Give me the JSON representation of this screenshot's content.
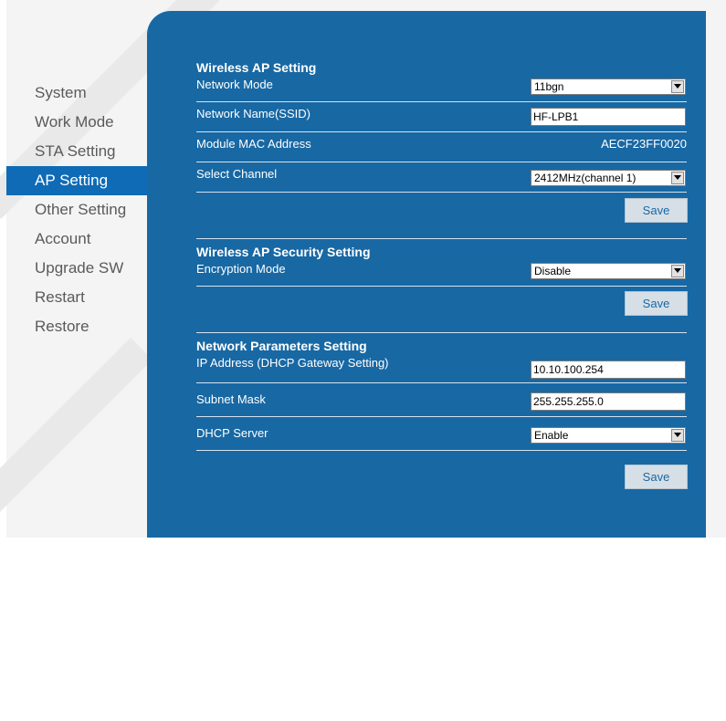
{
  "sidebar": {
    "items": [
      {
        "label": "System"
      },
      {
        "label": "Work Mode"
      },
      {
        "label": "STA Setting"
      },
      {
        "label": "AP Setting",
        "active": true
      },
      {
        "label": "Other Setting"
      },
      {
        "label": "Account"
      },
      {
        "label": "Upgrade SW"
      },
      {
        "label": "Restart"
      },
      {
        "label": "Restore"
      }
    ]
  },
  "wireless_ap": {
    "title": "Wireless AP Setting",
    "network_mode": {
      "label": "Network Mode",
      "value": "11bgn"
    },
    "ssid": {
      "label": "Network Name(SSID)",
      "value": "HF-LPB1"
    },
    "mac": {
      "label": "Module MAC Address",
      "value": "AECF23FF0020"
    },
    "channel": {
      "label": "Select Channel",
      "value": "2412MHz(channel 1)"
    },
    "save_label": "Save"
  },
  "security": {
    "title": "Wireless AP Security Setting",
    "encryption": {
      "label": "Encryption Mode",
      "value": "Disable"
    },
    "save_label": "Save"
  },
  "network": {
    "title": "Network Parameters Setting",
    "ip": {
      "label": "IP Address (DHCP Gateway Setting)",
      "value": "10.10.100.254"
    },
    "subnet": {
      "label": "Subnet Mask",
      "value": "255.255.255.0"
    },
    "dhcp": {
      "label": "DHCP Server",
      "value": "Enable"
    },
    "save_label": "Save"
  },
  "colors": {
    "panel": "#1868a4",
    "active_nav": "#0f6bb5",
    "nav_text": "#5a5a5a"
  }
}
